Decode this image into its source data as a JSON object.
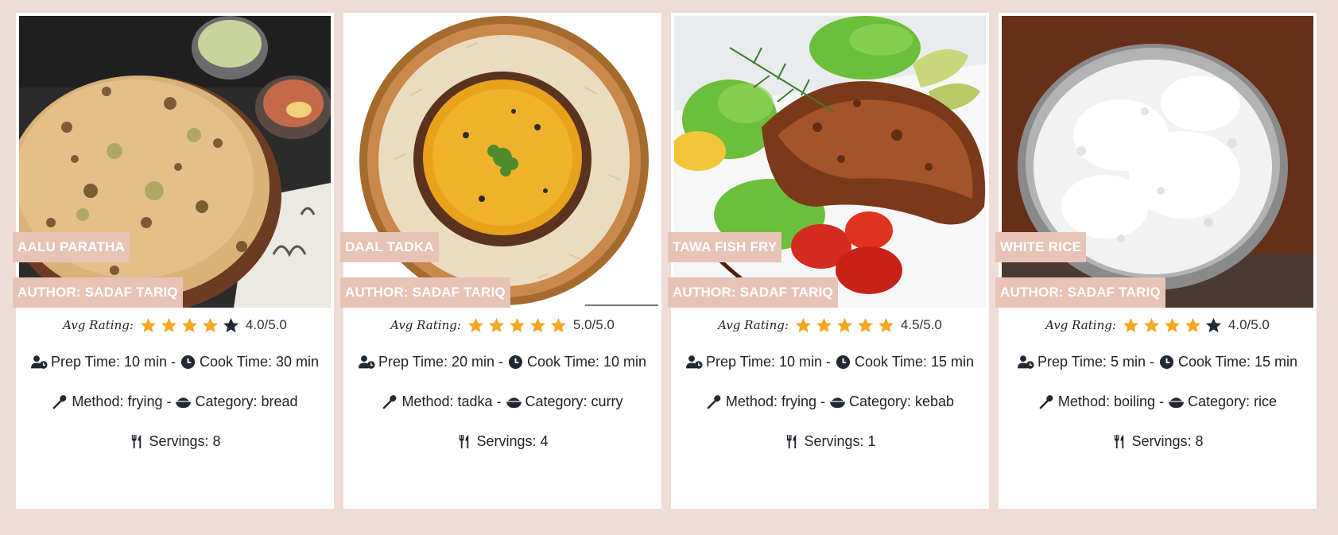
{
  "recipes": [
    {
      "title": "AALU PARATHA",
      "author": "AUTHOR: SADAF TARIQ",
      "rating_label": "Avg Rating:",
      "stars": 4,
      "rating_text": "4.0/5.0",
      "prep": "Prep Time: 10 min",
      "cook": "Cook Time: 30 min",
      "method": "Method: frying",
      "category": "Category: bread",
      "servings": "Servings: 8"
    },
    {
      "title": "DAAL TADKA",
      "author": "AUTHOR: SADAF TARIQ",
      "rating_label": "Avg Rating:",
      "stars": 5,
      "rating_text": "5.0/5.0",
      "prep": "Prep Time: 20 min",
      "cook": "Cook Time: 10 min",
      "method": "Method: tadka",
      "category": "Category: curry",
      "servings": "Servings: 4"
    },
    {
      "title": "TAWA FISH FRY",
      "author": "AUTHOR: SADAF TARIQ",
      "rating_label": "Avg Rating:",
      "stars": 5,
      "rating_text": "4.5/5.0",
      "prep": "Prep Time: 10 min",
      "cook": "Cook Time: 15 min",
      "method": "Method: frying",
      "category": "Category: kebab",
      "servings": "Servings: 1"
    },
    {
      "title": "WHITE RICE",
      "author": "AUTHOR: SADAF TARIQ",
      "rating_label": "Avg Rating:",
      "stars": 4,
      "rating_text": "4.0/5.0",
      "prep": "Prep Time: 5 min",
      "cook": "Cook Time: 15 min",
      "method": "Method: boiling",
      "category": "Category: rice",
      "servings": "Servings: 8"
    }
  ],
  "separator": "-",
  "colors": {
    "page_background": "#efdcd7",
    "tag_background": "#e7c3b6",
    "star_filled": "#f5a623",
    "star_empty": "#1f2a37",
    "text": "#222831"
  },
  "icons": {
    "prep": "user-clock-icon",
    "cook": "clock-icon",
    "method": "spoon-icon",
    "category": "bowl-icon",
    "servings": "utensils-icon"
  }
}
